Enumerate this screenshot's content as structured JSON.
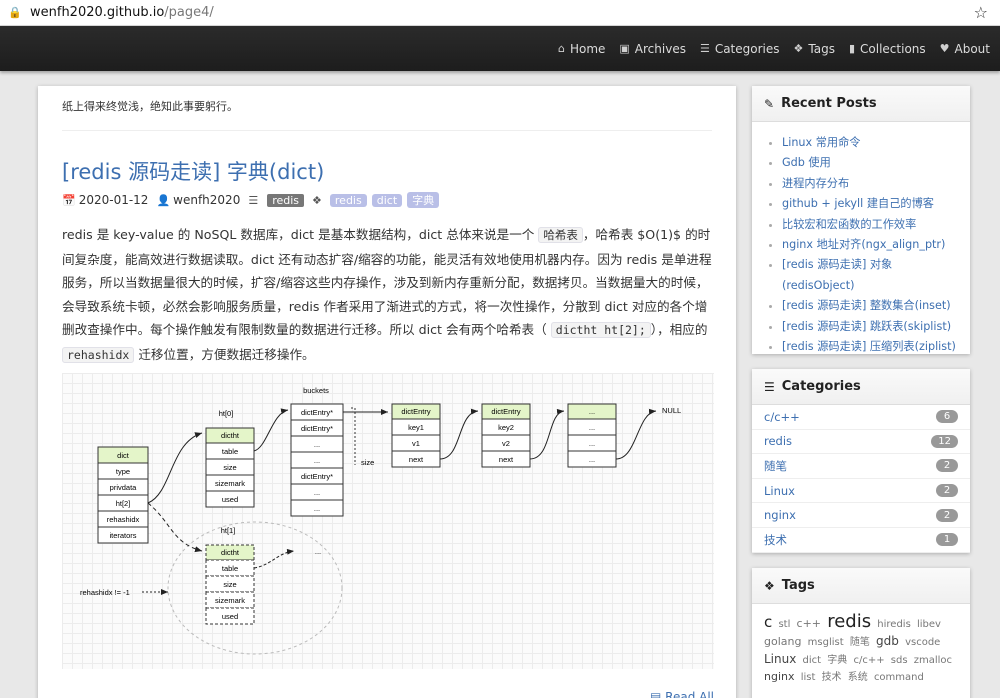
{
  "browser": {
    "url_host": "wenfh2020.github.io",
    "url_path": "/page4/"
  },
  "nav": {
    "items": [
      {
        "label": "Home",
        "icon": "home-icon"
      },
      {
        "label": "Archives",
        "icon": "archive-icon"
      },
      {
        "label": "Categories",
        "icon": "list-icon"
      },
      {
        "label": "Tags",
        "icon": "tags-icon"
      },
      {
        "label": "Collections",
        "icon": "bookmark-icon"
      },
      {
        "label": "About",
        "icon": "heart-icon"
      }
    ]
  },
  "main": {
    "motto": "纸上得来终觉浅，绝知此事要躬行。",
    "post": {
      "title": "[redis 源码走读] 字典(dict)",
      "date": "2020-01-12",
      "author": "wenfh2020",
      "category": "redis",
      "tags": [
        "redis",
        "dict",
        "字典"
      ],
      "body_1": "redis 是 key-value 的 NoSQL 数据库，dict 是基本数据结构，dict 总体来说是一个",
      "code_1": "哈希表",
      "body_2": "，哈希表 $O(1)$ 的时间复杂度，能高效进行数据读取。dict 还有动态扩容/缩容的功能，能灵活有效地使用机器内存。因为 redis 是单进程服务，所以当数据量很大的时候，扩容/缩容这些内存操作，涉及到新内存重新分配，数据拷贝。当数据量大的时候，会导致系统卡顿，必然会影响服务质量，redis 作者采用了渐进式的方式，将一次性操作，分散到 dict 对应的各个增删改查操作中。每个操作触发有限制数量的数据进行迁移。所以 dict 会有两个哈希表（",
      "code_2": "dictht ht[2];",
      "body_3": "），相应的",
      "code_3": "rehashidx",
      "body_4": "迁移位置，方便数据迁移操作。",
      "read_all": "Read All"
    },
    "diagram": {
      "dict_title": "dict",
      "dict_fields": [
        "type",
        "privdata",
        "ht[2]",
        "rehashidx",
        "iterators"
      ],
      "ht0_label": "ht[0]",
      "ht1_label": "ht[1]",
      "dictht_title": "dictht",
      "dictht_fields": [
        "table",
        "size",
        "sizemark",
        "used"
      ],
      "buckets_label": "buckets",
      "bucket_cells": [
        "dictEntry*",
        "dictEntry*",
        "...",
        "...",
        "dictEntry*",
        "...",
        "..."
      ],
      "size_label": "size",
      "entry_title": "dictEntry",
      "entry1": [
        "key1",
        "v1",
        "next"
      ],
      "entry2": [
        "key2",
        "v2",
        "next"
      ],
      "entry3_title": "...",
      "entry3": [
        "...",
        "...",
        "..."
      ],
      "null_label": "NULL",
      "rehash_label": "rehashidx != -1",
      "ellipsis": "..."
    }
  },
  "sidebar": {
    "recent": {
      "title": "Recent Posts",
      "items": [
        "Linux 常用命令",
        "Gdb 使用",
        "进程内存分布",
        "github + jekyll 建自己的博客",
        "比较宏和宏函数的工作效率",
        "nginx 地址对齐(ngx_align_ptr)",
        "[redis 源码走读] 对象(redisObject)",
        "[redis 源码走读] 整数集合(inset)",
        "[redis 源码走读] 跳跃表(skiplist)",
        "[redis 源码走读] 压缩列表(ziplist)"
      ]
    },
    "categories": {
      "title": "Categories",
      "items": [
        {
          "name": "c/c++",
          "count": "6"
        },
        {
          "name": "redis",
          "count": "12"
        },
        {
          "name": "随笔",
          "count": "2"
        },
        {
          "name": "Linux",
          "count": "2"
        },
        {
          "name": "nginx",
          "count": "2"
        },
        {
          "name": "技术",
          "count": "1"
        }
      ]
    },
    "tags": {
      "title": "Tags",
      "items": [
        "c",
        "stl",
        "c++",
        "redis",
        "hiredis",
        "libev",
        "golang",
        "msglist",
        "随笔",
        "gdb",
        "vscode",
        "Linux",
        "dict",
        "字典",
        "c/c++",
        "sds",
        "zmalloc",
        "nginx",
        "list",
        "技术",
        "系统",
        "command"
      ]
    }
  }
}
